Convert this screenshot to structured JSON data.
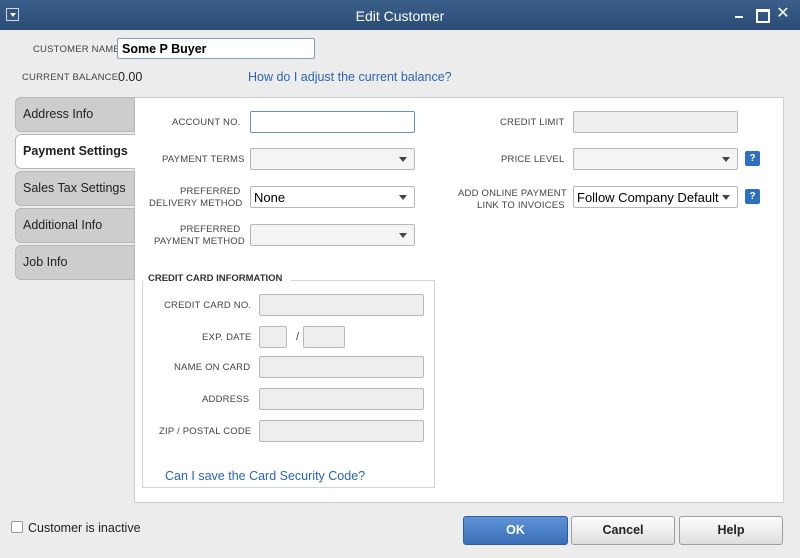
{
  "window": {
    "title": "Edit Customer"
  },
  "customer": {
    "name_label": "CUSTOMER NAME",
    "name_value": "Some P Buyer",
    "balance_label": "CURRENT BALANCE",
    "balance_value": "0.00",
    "adjust_link": "How do I adjust the current balance?"
  },
  "tabs": [
    {
      "label": "Address Info",
      "active": false
    },
    {
      "label": "Payment Settings",
      "active": true
    },
    {
      "label": "Sales Tax Settings",
      "active": false
    },
    {
      "label": "Additional Info",
      "active": false
    },
    {
      "label": "Job Info",
      "active": false
    }
  ],
  "payment": {
    "account_no_label": "ACCOUNT NO.",
    "account_no_value": "",
    "payment_terms_label": "PAYMENT TERMS",
    "payment_terms_value": "",
    "delivery_label_1": "PREFERRED",
    "delivery_label_2": "DELIVERY METHOD",
    "delivery_value": "None",
    "pay_method_label_1": "PREFERRED",
    "pay_method_label_2": "PAYMENT METHOD",
    "pay_method_value": "",
    "credit_limit_label": "CREDIT LIMIT",
    "credit_limit_value": "",
    "price_level_label": "PRICE LEVEL",
    "price_level_value": "",
    "online_label_1": "ADD ONLINE PAYMENT",
    "online_label_2": "LINK TO INVOICES",
    "online_value": "Follow Company Default",
    "help_glyph": "?"
  },
  "credit_card": {
    "section_title": "CREDIT CARD INFORMATION",
    "card_no_label": "CREDIT CARD NO.",
    "exp_label": "EXP. DATE",
    "exp_separator": "/",
    "name_label": "NAME ON CARD",
    "address_label": "ADDRESS",
    "zip_label": "ZIP / POSTAL CODE",
    "security_link": "Can I save the Card Security Code?"
  },
  "footer": {
    "inactive_label": "Customer is inactive",
    "inactive_checked": false,
    "ok_label": "OK",
    "cancel_label": "Cancel",
    "help_label": "Help"
  },
  "colors": {
    "titlebar": "#2b4d76",
    "link": "#2a64b8",
    "primary_button": "#3a6fb8"
  }
}
